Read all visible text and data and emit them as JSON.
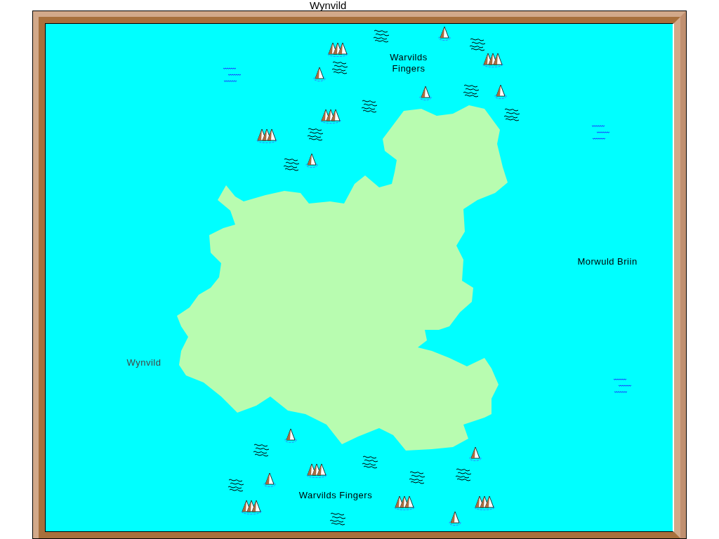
{
  "map": {
    "title": "Wynvild",
    "labels": [
      {
        "text": "Warvilds Fingers"
      },
      {
        "text": "Morwuld Briin"
      },
      {
        "text": "Wynvild"
      },
      {
        "text": "Warvilds Fingers"
      }
    ]
  }
}
